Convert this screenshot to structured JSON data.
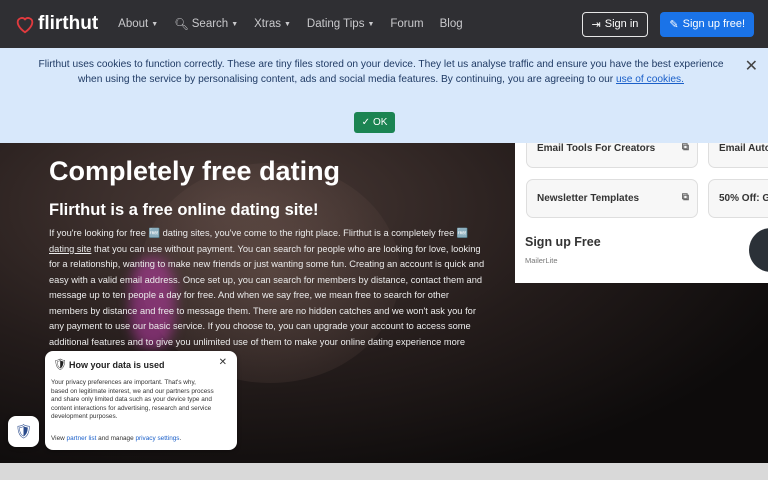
{
  "header": {
    "logo_text": "flirthut",
    "nav": [
      {
        "label": "About",
        "dropdown": true
      },
      {
        "label": "Search",
        "dropdown": true
      },
      {
        "label": "Xtras",
        "dropdown": true
      },
      {
        "label": "Dating Tips",
        "dropdown": true
      },
      {
        "label": "Forum",
        "dropdown": false
      },
      {
        "label": "Blog",
        "dropdown": false
      }
    ],
    "signin_label": "Sign in",
    "signup_label": "Sign up free!"
  },
  "cookie_banner": {
    "text": "Flirthut uses cookies to function correctly. These are tiny files stored on your device. They let us analyse traffic and ensure you have the best experience when using the service by personalising content, ads and social media features. By continuing, you are agreeing to our ",
    "link_text": "use of cookies.",
    "ok_label": "OK"
  },
  "hero": {
    "title": "Completely free dating",
    "subtitle": "Flirthut is a free online dating site!",
    "paragraph_start": "If you're looking for free 🆓 dating sites, you've come to the right place. Flirthut is a completely free 🆓 ",
    "paragraph_link": "dating site",
    "paragraph_rest": " that you can use without payment. You can search for people who are looking for love, looking for a relationship, wanting to make new friends or just wanting some fun. Creating an account is quick and easy with a valid email address. Once set up, you can search for members by distance, contact them and message up to ten people a day for free. And when we say free, we mean free to search for other members by distance and free to message them. There are no hidden catches and we won't ask you for any payment to use our basic service. If you choose to, you can upgrade your account to access some additional features and to give you unlimited use of them to make your online dating experience more exciting."
  },
  "ad": {
    "cards": [
      "Email Tools For Creators",
      "Email Auto",
      "Newsletter Templates",
      "50% Off: G"
    ],
    "title": "Sign up Free",
    "sponsor": "MailerLite"
  },
  "privacy": {
    "title": "How your data is used",
    "body": "Your privacy preferences are important. That's why, based on legitimate interest, we and our partners process and share only limited data such as your device type and content interactions for advertising, research and service development purposes.",
    "foot_view": "View ",
    "foot_link1": "partner list",
    "foot_mid": " and manage ",
    "foot_link2": "privacy settings",
    "foot_end": "."
  },
  "colors": {
    "navbar": "#2f2f33",
    "brand_red": "#e03a3e",
    "primary": "#1a73e8",
    "ok_green": "#1b8452",
    "cookie_bg": "#d8e8fb"
  }
}
